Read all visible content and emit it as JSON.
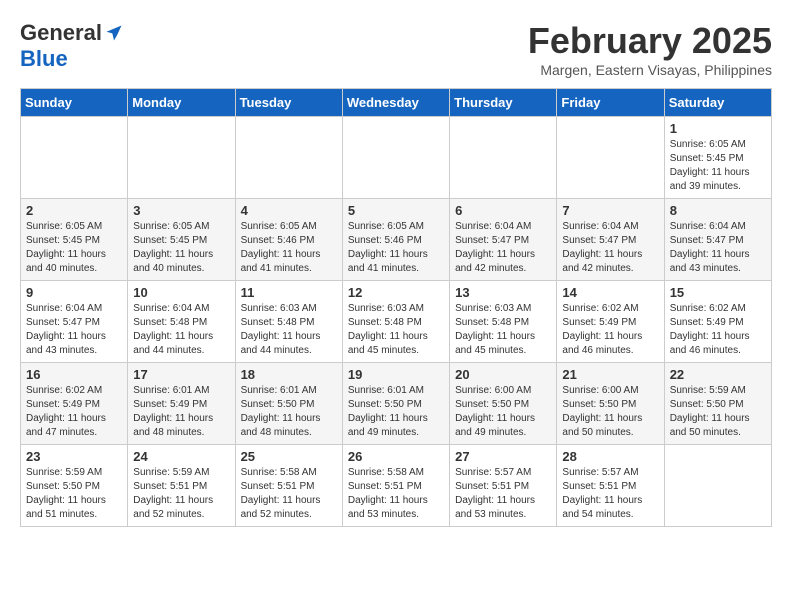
{
  "header": {
    "logo_general": "General",
    "logo_blue": "Blue",
    "month_title": "February 2025",
    "location": "Margen, Eastern Visayas, Philippines"
  },
  "weekdays": [
    "Sunday",
    "Monday",
    "Tuesday",
    "Wednesday",
    "Thursday",
    "Friday",
    "Saturday"
  ],
  "weeks": [
    [
      {
        "day": "",
        "info": ""
      },
      {
        "day": "",
        "info": ""
      },
      {
        "day": "",
        "info": ""
      },
      {
        "day": "",
        "info": ""
      },
      {
        "day": "",
        "info": ""
      },
      {
        "day": "",
        "info": ""
      },
      {
        "day": "1",
        "info": "Sunrise: 6:05 AM\nSunset: 5:45 PM\nDaylight: 11 hours and 39 minutes."
      }
    ],
    [
      {
        "day": "2",
        "info": "Sunrise: 6:05 AM\nSunset: 5:45 PM\nDaylight: 11 hours and 40 minutes."
      },
      {
        "day": "3",
        "info": "Sunrise: 6:05 AM\nSunset: 5:45 PM\nDaylight: 11 hours and 40 minutes."
      },
      {
        "day": "4",
        "info": "Sunrise: 6:05 AM\nSunset: 5:46 PM\nDaylight: 11 hours and 41 minutes."
      },
      {
        "day": "5",
        "info": "Sunrise: 6:05 AM\nSunset: 5:46 PM\nDaylight: 11 hours and 41 minutes."
      },
      {
        "day": "6",
        "info": "Sunrise: 6:04 AM\nSunset: 5:47 PM\nDaylight: 11 hours and 42 minutes."
      },
      {
        "day": "7",
        "info": "Sunrise: 6:04 AM\nSunset: 5:47 PM\nDaylight: 11 hours and 42 minutes."
      },
      {
        "day": "8",
        "info": "Sunrise: 6:04 AM\nSunset: 5:47 PM\nDaylight: 11 hours and 43 minutes."
      }
    ],
    [
      {
        "day": "9",
        "info": "Sunrise: 6:04 AM\nSunset: 5:47 PM\nDaylight: 11 hours and 43 minutes."
      },
      {
        "day": "10",
        "info": "Sunrise: 6:04 AM\nSunset: 5:48 PM\nDaylight: 11 hours and 44 minutes."
      },
      {
        "day": "11",
        "info": "Sunrise: 6:03 AM\nSunset: 5:48 PM\nDaylight: 11 hours and 44 minutes."
      },
      {
        "day": "12",
        "info": "Sunrise: 6:03 AM\nSunset: 5:48 PM\nDaylight: 11 hours and 45 minutes."
      },
      {
        "day": "13",
        "info": "Sunrise: 6:03 AM\nSunset: 5:48 PM\nDaylight: 11 hours and 45 minutes."
      },
      {
        "day": "14",
        "info": "Sunrise: 6:02 AM\nSunset: 5:49 PM\nDaylight: 11 hours and 46 minutes."
      },
      {
        "day": "15",
        "info": "Sunrise: 6:02 AM\nSunset: 5:49 PM\nDaylight: 11 hours and 46 minutes."
      }
    ],
    [
      {
        "day": "16",
        "info": "Sunrise: 6:02 AM\nSunset: 5:49 PM\nDaylight: 11 hours and 47 minutes."
      },
      {
        "day": "17",
        "info": "Sunrise: 6:01 AM\nSunset: 5:49 PM\nDaylight: 11 hours and 48 minutes."
      },
      {
        "day": "18",
        "info": "Sunrise: 6:01 AM\nSunset: 5:50 PM\nDaylight: 11 hours and 48 minutes."
      },
      {
        "day": "19",
        "info": "Sunrise: 6:01 AM\nSunset: 5:50 PM\nDaylight: 11 hours and 49 minutes."
      },
      {
        "day": "20",
        "info": "Sunrise: 6:00 AM\nSunset: 5:50 PM\nDaylight: 11 hours and 49 minutes."
      },
      {
        "day": "21",
        "info": "Sunrise: 6:00 AM\nSunset: 5:50 PM\nDaylight: 11 hours and 50 minutes."
      },
      {
        "day": "22",
        "info": "Sunrise: 5:59 AM\nSunset: 5:50 PM\nDaylight: 11 hours and 50 minutes."
      }
    ],
    [
      {
        "day": "23",
        "info": "Sunrise: 5:59 AM\nSunset: 5:50 PM\nDaylight: 11 hours and 51 minutes."
      },
      {
        "day": "24",
        "info": "Sunrise: 5:59 AM\nSunset: 5:51 PM\nDaylight: 11 hours and 52 minutes."
      },
      {
        "day": "25",
        "info": "Sunrise: 5:58 AM\nSunset: 5:51 PM\nDaylight: 11 hours and 52 minutes."
      },
      {
        "day": "26",
        "info": "Sunrise: 5:58 AM\nSunset: 5:51 PM\nDaylight: 11 hours and 53 minutes."
      },
      {
        "day": "27",
        "info": "Sunrise: 5:57 AM\nSunset: 5:51 PM\nDaylight: 11 hours and 53 minutes."
      },
      {
        "day": "28",
        "info": "Sunrise: 5:57 AM\nSunset: 5:51 PM\nDaylight: 11 hours and 54 minutes."
      },
      {
        "day": "",
        "info": ""
      }
    ]
  ]
}
